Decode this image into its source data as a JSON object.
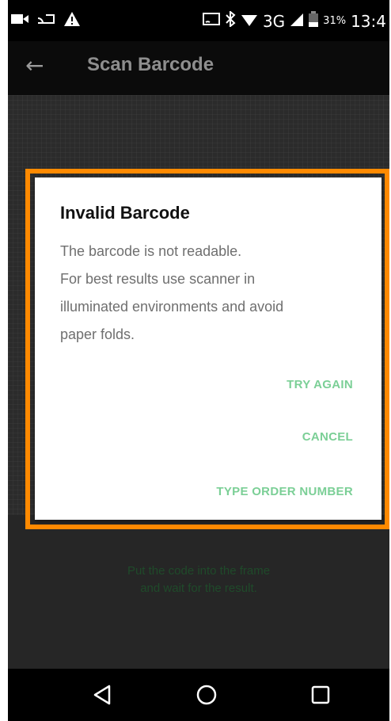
{
  "status_bar": {
    "network": "3G",
    "battery_percent": "31%",
    "time": "13:4",
    "icons": [
      "video-icon",
      "cast-icon",
      "warning-icon",
      "screen-mirror-icon",
      "bluetooth-icon",
      "wifi-icon",
      "signal-icon",
      "battery-icon"
    ]
  },
  "app_bar": {
    "title": "Scan Barcode",
    "back_icon": "back-arrow-icon"
  },
  "camera": {
    "hint_line1": "Put the code into the frame",
    "hint_line2": "and wait for the result."
  },
  "dialog": {
    "title": "Invalid Barcode",
    "body_lines": [
      "The barcode is not readable.",
      "For best results use scanner in",
      "illuminated environments and avoid",
      "paper folds."
    ],
    "buttons": {
      "try_again": "TRY AGAIN",
      "cancel": "CANCEL",
      "type_order_number": "TYPE ORDER NUMBER"
    },
    "button_color": "#7bcf96",
    "highlight_color": "#ff8a00"
  },
  "nav_bar": {
    "icons": [
      "nav-back-icon",
      "nav-home-icon",
      "nav-recents-icon"
    ]
  }
}
